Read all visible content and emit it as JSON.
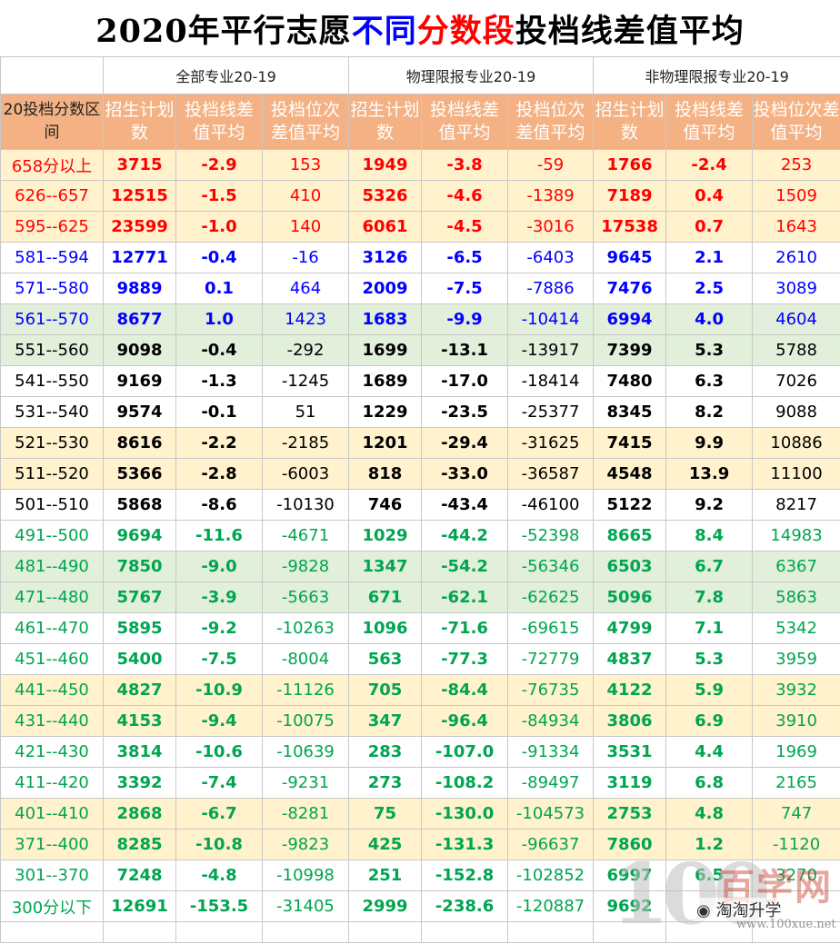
{
  "title": {
    "part1": "2020年平行志愿",
    "part2": "不同",
    "part3": "分数段",
    "part4": "投档线差值平均"
  },
  "groups": [
    "全部专业20-19",
    "物理限报专业20-19",
    "非物理限报专业20-19"
  ],
  "headers": [
    "20投档分数区间",
    "招生计划数",
    "投档线差值平均",
    "投档位次差值平均",
    "招生计划数",
    "投档线差值平均",
    "投档位次差值平均",
    "招生计划数",
    "投档线差值平均",
    "投档位次差值平均"
  ],
  "rows": [
    [
      "658分以上",
      "3715",
      "-2.9",
      "153",
      "1949",
      "-3.8",
      "-59",
      "1766",
      "-2.4",
      "253"
    ],
    [
      "626--657",
      "12515",
      "-1.5",
      "410",
      "5326",
      "-4.6",
      "-1389",
      "7189",
      "0.4",
      "1509"
    ],
    [
      "595--625",
      "23599",
      "-1.0",
      "140",
      "6061",
      "-4.5",
      "-3016",
      "17538",
      "0.7",
      "1643"
    ],
    [
      "581--594",
      "12771",
      "-0.4",
      "-16",
      "3126",
      "-6.5",
      "-6403",
      "9645",
      "2.1",
      "2610"
    ],
    [
      "571--580",
      "9889",
      "0.1",
      "464",
      "2009",
      "-7.5",
      "-7886",
      "7476",
      "2.5",
      "3089"
    ],
    [
      "561--570",
      "8677",
      "1.0",
      "1423",
      "1683",
      "-9.9",
      "-10414",
      "6994",
      "4.0",
      "4604"
    ],
    [
      "551--560",
      "9098",
      "-0.4",
      "-292",
      "1699",
      "-13.1",
      "-13917",
      "7399",
      "5.3",
      "5788"
    ],
    [
      "541--550",
      "9169",
      "-1.3",
      "-1245",
      "1689",
      "-17.0",
      "-18414",
      "7480",
      "6.3",
      "7026"
    ],
    [
      "531--540",
      "9574",
      "-0.1",
      "51",
      "1229",
      "-23.5",
      "-25377",
      "8345",
      "8.2",
      "9088"
    ],
    [
      "521--530",
      "8616",
      "-2.2",
      "-2185",
      "1201",
      "-29.4",
      "-31625",
      "7415",
      "9.9",
      "10886"
    ],
    [
      "511--520",
      "5366",
      "-2.8",
      "-6003",
      "818",
      "-33.0",
      "-36587",
      "4548",
      "13.9",
      "11100"
    ],
    [
      "501--510",
      "5868",
      "-8.6",
      "-10130",
      "746",
      "-43.4",
      "-46100",
      "5122",
      "9.2",
      "8217"
    ],
    [
      "491--500",
      "9694",
      "-11.6",
      "-4671",
      "1029",
      "-44.2",
      "-52398",
      "8665",
      "8.4",
      "14983"
    ],
    [
      "481--490",
      "7850",
      "-9.0",
      "-9828",
      "1347",
      "-54.2",
      "-56346",
      "6503",
      "6.7",
      "6367"
    ],
    [
      "471--480",
      "5767",
      "-3.9",
      "-5663",
      "671",
      "-62.1",
      "-62625",
      "5096",
      "7.8",
      "5863"
    ],
    [
      "461--470",
      "5895",
      "-9.2",
      "-10263",
      "1096",
      "-71.6",
      "-69615",
      "4799",
      "7.1",
      "5342"
    ],
    [
      "451--460",
      "5400",
      "-7.5",
      "-8004",
      "563",
      "-77.3",
      "-72779",
      "4837",
      "5.3",
      "3959"
    ],
    [
      "441--450",
      "4827",
      "-10.9",
      "-11126",
      "705",
      "-84.4",
      "-76735",
      "4122",
      "5.9",
      "3932"
    ],
    [
      "431--440",
      "4153",
      "-9.4",
      "-10075",
      "347",
      "-96.4",
      "-84934",
      "3806",
      "6.9",
      "3910"
    ],
    [
      "421--430",
      "3814",
      "-10.6",
      "-10639",
      "283",
      "-107.0",
      "-91334",
      "3531",
      "4.4",
      "1969"
    ],
    [
      "411--420",
      "3392",
      "-7.4",
      "-9231",
      "273",
      "-108.2",
      "-89497",
      "3119",
      "6.8",
      "2165"
    ],
    [
      "401--410",
      "2868",
      "-6.7",
      "-8281",
      "75",
      "-130.0",
      "-104573",
      "2753",
      "4.8",
      "747"
    ],
    [
      "371--400",
      "8285",
      "-10.8",
      "-9823",
      "425",
      "-131.3",
      "-96637",
      "7860",
      "1.2",
      "-1120"
    ],
    [
      "301--370",
      "7248",
      "-4.8",
      "-10998",
      "251",
      "-152.8",
      "-102852",
      "6997",
      "6.5",
      "3270"
    ],
    [
      "300分以下",
      "12691",
      "-153.5",
      "-31405",
      "2999",
      "-238.6",
      "-120887",
      "9692",
      "",
      ""
    ]
  ],
  "row_backgrounds": [
    "#fff2cc",
    "#fff2cc",
    "#fff2cc",
    "#ffffff",
    "#ffffff",
    "#e2efda",
    "#e2efda",
    "#ffffff",
    "#ffffff",
    "#fff2cc",
    "#fff2cc",
    "#ffffff",
    "#ffffff",
    "#e2efda",
    "#e2efda",
    "#ffffff",
    "#ffffff",
    "#fff2cc",
    "#fff2cc",
    "#ffffff",
    "#ffffff",
    "#fff2cc",
    "#fff2cc",
    "#ffffff",
    "#ffffff"
  ],
  "row_text_colors": [
    "#ff0000",
    "#ff0000",
    "#ff0000",
    "#0000ff",
    "#0000ff",
    "#0000ff",
    "#000000",
    "#000000",
    "#000000",
    "#000000",
    "#000000",
    "#000000",
    "#00a550",
    "#00a550",
    "#00a550",
    "#00a550",
    "#00a550",
    "#00a550",
    "#00a550",
    "#00a550",
    "#00a550",
    "#00a550",
    "#00a550",
    "#00a550",
    "#00a550"
  ],
  "colors": {
    "header_bg": "#f4b183",
    "title_blue": "#0000ff",
    "title_red": "#ff0000"
  },
  "watermark": {
    "logo_number": "100",
    "logo_text": "百学网",
    "wechat_label": "淘淘升学",
    "url": "www.100xue.net",
    "icon": "wechat-icon"
  }
}
